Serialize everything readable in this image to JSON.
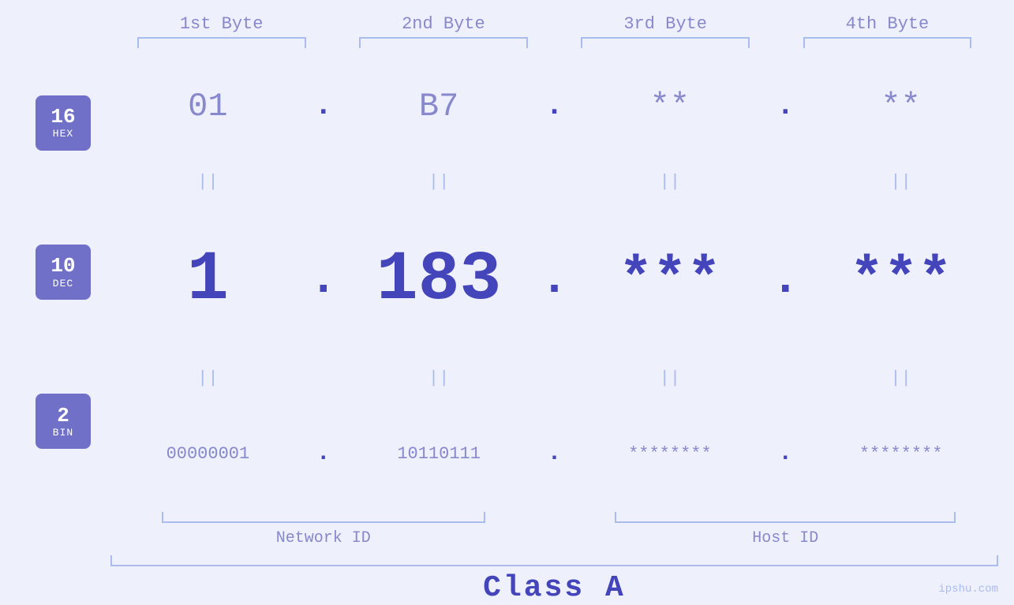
{
  "header": {
    "bytes": [
      "1st Byte",
      "2nd Byte",
      "3rd Byte",
      "4th Byte"
    ]
  },
  "badges": [
    {
      "number": "16",
      "label": "HEX"
    },
    {
      "number": "10",
      "label": "DEC"
    },
    {
      "number": "2",
      "label": "BIN"
    }
  ],
  "rows": {
    "hex": {
      "values": [
        "01",
        "B7",
        "**",
        "**"
      ],
      "dots": [
        ".",
        ".",
        "."
      ]
    },
    "dec": {
      "values": [
        "1",
        "183",
        "***",
        "***"
      ],
      "dots": [
        ".",
        ".",
        "."
      ]
    },
    "bin": {
      "values": [
        "00000001",
        "10110111",
        "********",
        "********"
      ],
      "dots": [
        ".",
        ".",
        "."
      ]
    }
  },
  "equals": [
    "||",
    "||",
    "||",
    "||"
  ],
  "bottom": {
    "network_id": "Network ID",
    "host_id": "Host ID",
    "class": "Class A"
  },
  "watermark": "ipshu.com"
}
